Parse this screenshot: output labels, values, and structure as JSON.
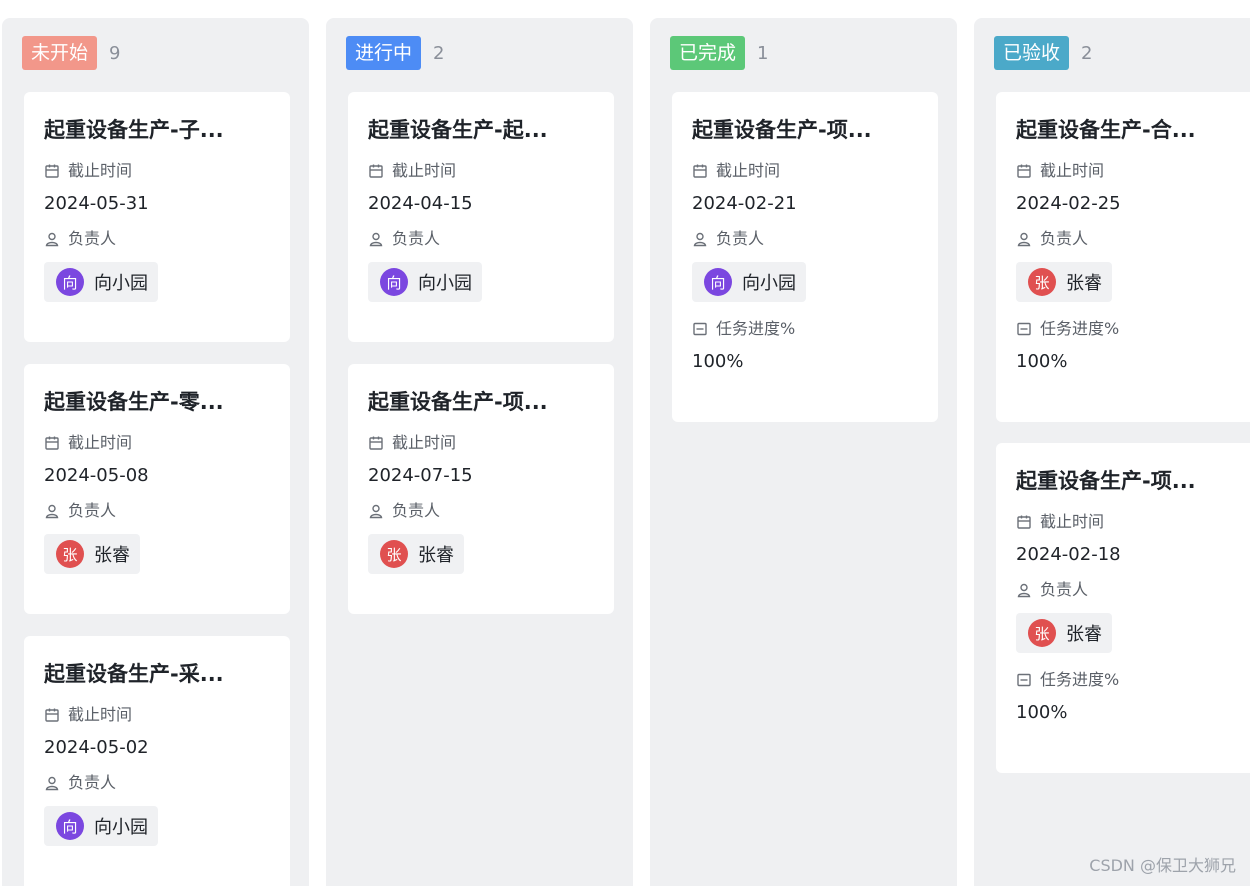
{
  "board": {
    "columns": [
      {
        "status": "未开始",
        "count": "9",
        "color": "#f2978a",
        "cards": [
          {
            "title": "起重设备生产-子...",
            "deadline_label": "截止时间",
            "deadline": "2024-05-31",
            "owner_label": "负责人",
            "owner_initial": "向",
            "owner": "向小园",
            "avatar_color": "#7b47e0"
          },
          {
            "title": "起重设备生产-零...",
            "deadline_label": "截止时间",
            "deadline": "2024-05-08",
            "owner_label": "负责人",
            "owner_initial": "张",
            "owner": "张睿",
            "avatar_color": "#e05050"
          },
          {
            "title": "起重设备生产-采...",
            "deadline_label": "截止时间",
            "deadline": "2024-05-02",
            "owner_label": "负责人",
            "owner_initial": "向",
            "owner": "向小园",
            "avatar_color": "#7b47e0"
          }
        ]
      },
      {
        "status": "进行中",
        "count": "2",
        "color": "#4d8cf5",
        "cards": [
          {
            "title": "起重设备生产-起...",
            "deadline_label": "截止时间",
            "deadline": "2024-04-15",
            "owner_label": "负责人",
            "owner_initial": "向",
            "owner": "向小园",
            "avatar_color": "#7b47e0"
          },
          {
            "title": "起重设备生产-项...",
            "deadline_label": "截止时间",
            "deadline": "2024-07-15",
            "owner_label": "负责人",
            "owner_initial": "张",
            "owner": "张睿",
            "avatar_color": "#e05050"
          }
        ]
      },
      {
        "status": "已完成",
        "count": "1",
        "color": "#5cc878",
        "cards": [
          {
            "title": "起重设备生产-项...",
            "deadline_label": "截止时间",
            "deadline": "2024-02-21",
            "owner_label": "负责人",
            "owner_initial": "向",
            "owner": "向小园",
            "avatar_color": "#7b47e0",
            "progress_label": "任务进度%",
            "progress": "100%"
          }
        ]
      },
      {
        "status": "已验收",
        "count": "2",
        "color": "#4ba9c9",
        "cards": [
          {
            "title": "起重设备生产-合...",
            "deadline_label": "截止时间",
            "deadline": "2024-02-25",
            "owner_label": "负责人",
            "owner_initial": "张",
            "owner": "张睿",
            "avatar_color": "#e05050",
            "progress_label": "任务进度%",
            "progress": "100%"
          },
          {
            "title": "起重设备生产-项...",
            "deadline_label": "截止时间",
            "deadline": "2024-02-18",
            "owner_label": "负责人",
            "owner_initial": "张",
            "owner": "张睿",
            "avatar_color": "#e05050",
            "progress_label": "任务进度%",
            "progress": "100%"
          }
        ]
      }
    ]
  },
  "watermark": "CSDN @保卫大狮兄",
  "icons": {
    "deadline": "calendar-icon",
    "owner": "user-icon",
    "progress": "progress-icon"
  }
}
